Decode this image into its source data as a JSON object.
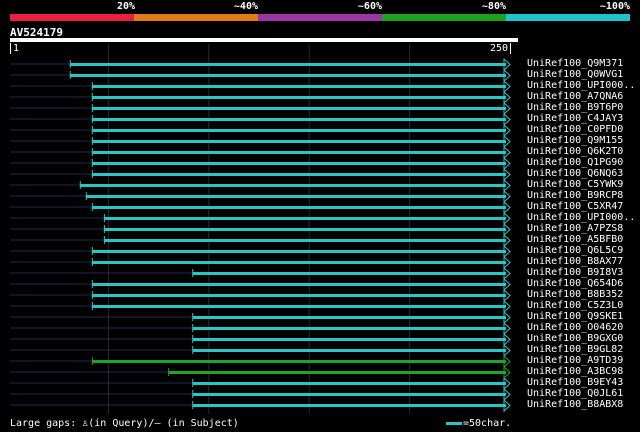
{
  "legend": {
    "colors": [
      "#e8223c",
      "#e07b18",
      "#9a36a6",
      "#1ba31b",
      "#20c3c7"
    ],
    "labels": [
      "20%",
      "~40%",
      "~60%",
      "~80%",
      "~100%"
    ]
  },
  "query": {
    "name": "AV524179",
    "start": "1",
    "end": "250"
  },
  "hits": [
    {
      "label": "UniRef100_Q9M371",
      "start": 31,
      "color": "cyan"
    },
    {
      "label": "UniRef100_Q0WVG1",
      "start": 31,
      "color": "cyan"
    },
    {
      "label": "UniRef100_UPI000..",
      "start": 42,
      "color": "cyan"
    },
    {
      "label": "UniRef100_A7QNA6",
      "start": 42,
      "color": "cyan"
    },
    {
      "label": "UniRef100_B9T6P0",
      "start": 42,
      "color": "cyan"
    },
    {
      "label": "UniRef100_C4JAY3",
      "start": 42,
      "color": "cyan"
    },
    {
      "label": "UniRef100_C0PFD0",
      "start": 42,
      "color": "cyan"
    },
    {
      "label": "UniRef100_Q9M155",
      "start": 42,
      "color": "cyan"
    },
    {
      "label": "UniRef100_Q6K2T0",
      "start": 42,
      "color": "cyan"
    },
    {
      "label": "UniRef100_Q1PG90",
      "start": 42,
      "color": "cyan"
    },
    {
      "label": "UniRef100_Q6NQ63",
      "start": 42,
      "color": "cyan"
    },
    {
      "label": "UniRef100_C5YWK9",
      "start": 36,
      "color": "cyan"
    },
    {
      "label": "UniRef100_B9RCP8",
      "start": 39,
      "color": "cyan"
    },
    {
      "label": "UniRef100_C5XR47",
      "start": 42,
      "color": "cyan"
    },
    {
      "label": "UniRef100_UPI000..",
      "start": 48,
      "color": "cyan"
    },
    {
      "label": "UniRef100_A7PZS8",
      "start": 48,
      "color": "cyan"
    },
    {
      "label": "UniRef100_A5BFB0",
      "start": 48,
      "color": "cyan"
    },
    {
      "label": "UniRef100_Q6L5C9",
      "start": 42,
      "color": "cyan"
    },
    {
      "label": "UniRef100_B8AX77",
      "start": 42,
      "color": "cyan"
    },
    {
      "label": "UniRef100_B9I8V3",
      "start": 92,
      "color": "cyan"
    },
    {
      "label": "UniRef100_Q654D6",
      "start": 42,
      "color": "cyan"
    },
    {
      "label": "UniRef100_B8B352",
      "start": 42,
      "color": "cyan"
    },
    {
      "label": "UniRef100_C5Z3L0",
      "start": 42,
      "color": "cyan"
    },
    {
      "label": "UniRef100_Q9SKE1",
      "start": 92,
      "color": "cyan"
    },
    {
      "label": "UniRef100_O04620",
      "start": 92,
      "color": "cyan"
    },
    {
      "label": "UniRef100_B9GXG0",
      "start": 92,
      "color": "cyan"
    },
    {
      "label": "UniRef100_B9GL82",
      "start": 92,
      "color": "cyan"
    },
    {
      "label": "UniRef100_A9TD39",
      "start": 42,
      "color": "green"
    },
    {
      "label": "UniRef100_A3BC98",
      "start": 80,
      "color": "green"
    },
    {
      "label": "UniRef100_B9EY43",
      "start": 92,
      "color": "cyan"
    },
    {
      "label": "UniRef100_Q0JL61",
      "start": 92,
      "color": "cyan"
    },
    {
      "label": "UniRef100_B8ABX8",
      "start": 92,
      "color": "cyan"
    }
  ],
  "hit_colors": {
    "cyan": "#29c6c6",
    "green": "#22a322"
  },
  "footer": {
    "gaps_text": "Large gaps: ♙(in Query)/– (in Subject)",
    "scale_text": "=50char."
  }
}
